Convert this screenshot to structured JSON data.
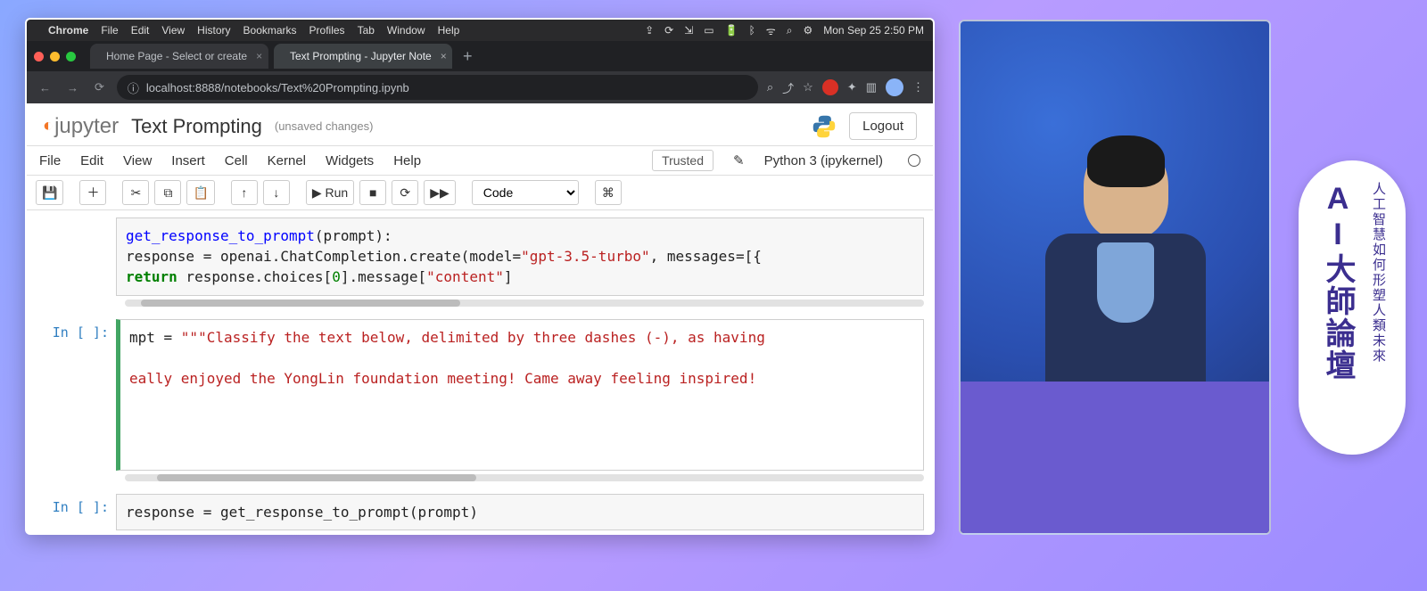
{
  "mac": {
    "apple": "",
    "app": "Chrome",
    "menus": [
      "File",
      "Edit",
      "View",
      "History",
      "Bookmarks",
      "Profiles",
      "Tab",
      "Window",
      "Help"
    ],
    "clock": "Mon Sep 25  2:50 PM"
  },
  "chrome": {
    "tabs": [
      {
        "title": "Home Page - Select or create",
        "active": false
      },
      {
        "title": "Text Prompting - Jupyter Note",
        "active": true
      }
    ],
    "new_tab": "+",
    "url": "localhost:8888/notebooks/Text%20Prompting.ipynb"
  },
  "jupyter": {
    "brand": "jupyter",
    "title": "Text Prompting",
    "status": "(unsaved changes)",
    "logout": "Logout",
    "menus": [
      "File",
      "Edit",
      "View",
      "Insert",
      "Cell",
      "Kernel",
      "Widgets",
      "Help"
    ],
    "trusted": "Trusted",
    "kernel": "Python 3 (ipykernel)",
    "toolbar": {
      "save": "💾",
      "add": "＋",
      "cut": "✂",
      "copy": "⧉",
      "paste": "📋",
      "up": "↑",
      "down": "↓",
      "run": "▶ Run",
      "stop": "■",
      "restart": "⟳",
      "ff": "▶▶",
      "celltype": "Code",
      "cmd": "⌘"
    },
    "cells": [
      {
        "prompt": "",
        "html": "<span class='fn'>get_response_to_prompt</span><span class='pln'>(prompt):</span>\n<span class='pln'>response = openai.ChatCompletion.create(model=</span><span class='str'>\"gpt-3.5-turbo\"</span><span class='pln'>, messages=[{</span>\n<span class='kw'>return</span><span class='pln'> response.choices[</span><span class='num'>0</span><span class='pln'>].message[</span><span class='str'>\"content\"</span><span class='pln'>]</span>"
      },
      {
        "prompt": "In [ ]:",
        "selected": true,
        "html": "<span class='pln'>mpt = </span><span class='str'>\"\"\"Classify the text below, delimited by three dashes (-), as having</span>\n\n<span class='str'>eally enjoyed the YongLin foundation meeting! Came away feeling inspired!</span>\n\n\n"
      },
      {
        "prompt": "In [ ]:",
        "html": "<span class='pln'>response = get_response_to_prompt(prompt)</span>"
      }
    ]
  },
  "badge": {
    "main": "AI大師論壇",
    "sub": "人工智慧如何形塑人類未來"
  }
}
